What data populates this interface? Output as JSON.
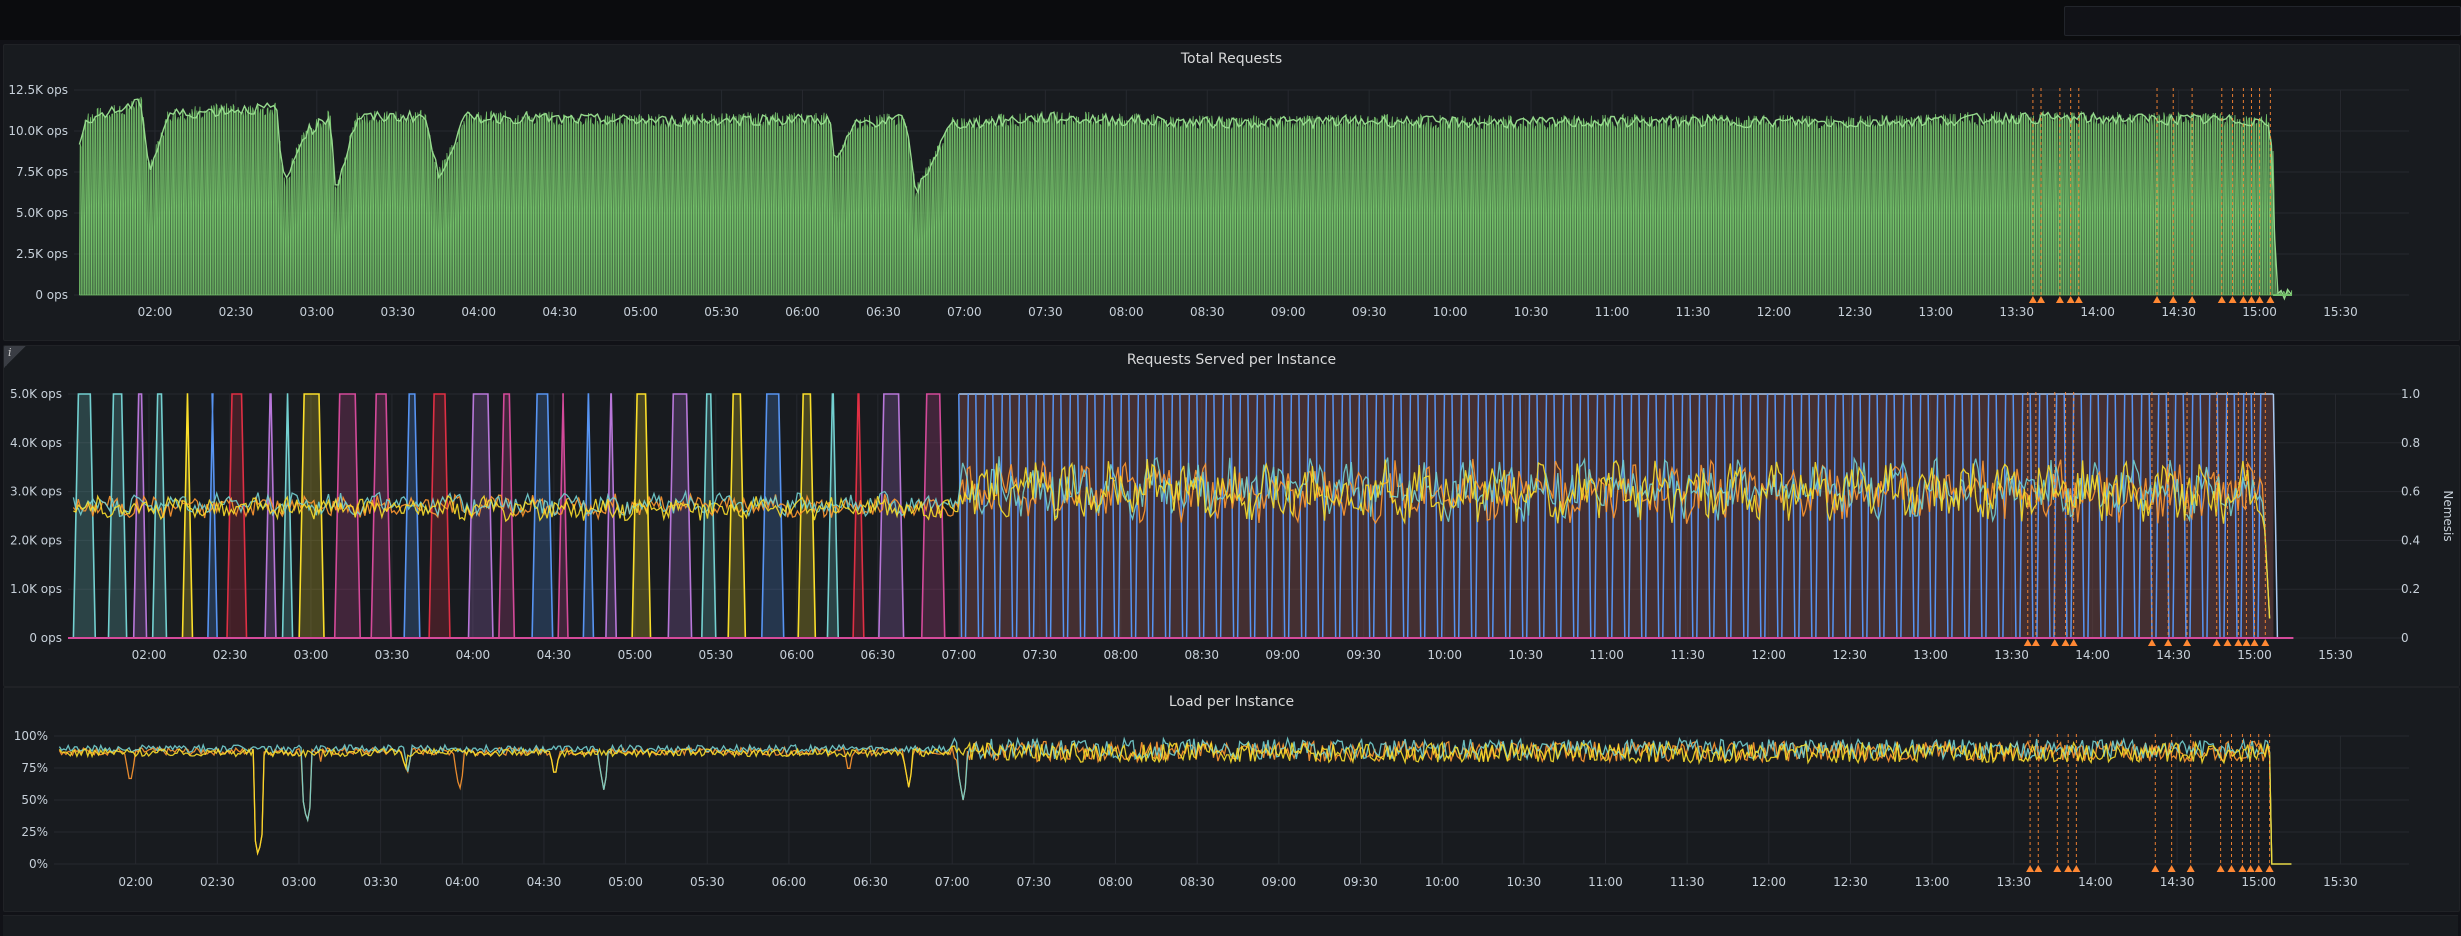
{
  "dashboard": {
    "bottom_title": "",
    "right_axis_label": "Nemesis"
  },
  "colors": {
    "panel_bg": "#181b1f",
    "grid": "#26292f",
    "text": "#c7d0d9",
    "green": "#73bf69",
    "orange": "#ff9830",
    "blue": "#5794f2",
    "red": "#e02f44",
    "purple": "#b877d9",
    "pink": "#d44a9a",
    "yellow": "#fade2a",
    "cyan": "#73d0d0",
    "annotation": "#ff8833"
  },
  "chart_data": [
    {
      "type": "area",
      "title": "Total Requests",
      "xlabel": "",
      "ylabel": "",
      "x_ticks": [
        "02:00",
        "02:30",
        "03:00",
        "03:30",
        "04:00",
        "04:30",
        "05:00",
        "05:30",
        "06:00",
        "06:30",
        "07:00",
        "07:30",
        "08:00",
        "08:30",
        "09:00",
        "09:30",
        "10:00",
        "10:30",
        "11:00",
        "11:30",
        "12:00",
        "12:30",
        "13:00",
        "13:30",
        "14:00",
        "14:30",
        "15:00",
        "15:30"
      ],
      "y_ticks": [
        "0 ops",
        "2.5K ops",
        "5.0K ops",
        "7.5K ops",
        "10.0K ops",
        "12.5K ops"
      ],
      "ylim": [
        0,
        12500
      ],
      "xlim": [
        "01:30",
        "15:35"
      ],
      "series": [
        {
          "name": "",
          "color": "#73bf69",
          "approx_profile": [
            [
              "01:32",
              9000
            ],
            [
              "01:35",
              10800
            ],
            [
              "01:45",
              11200
            ],
            [
              "01:55",
              11700
            ],
            [
              "01:58",
              7500
            ],
            [
              "02:05",
              11000
            ],
            [
              "02:30",
              11300
            ],
            [
              "02:45",
              11400
            ],
            [
              "02:48",
              6600
            ],
            [
              "02:55",
              9800
            ],
            [
              "03:05",
              10900
            ],
            [
              "03:07",
              6400
            ],
            [
              "03:15",
              10800
            ],
            [
              "03:40",
              10900
            ],
            [
              "03:45",
              7200
            ],
            [
              "03:55",
              10800
            ],
            [
              "04:20",
              10800
            ],
            [
              "04:30",
              10700
            ],
            [
              "04:40",
              10700
            ],
            [
              "05:10",
              10600
            ],
            [
              "05:40",
              10700
            ],
            [
              "06:10",
              10700
            ],
            [
              "06:12",
              8000
            ],
            [
              "06:20",
              10500
            ],
            [
              "06:38",
              10700
            ],
            [
              "06:42",
              6200
            ],
            [
              "06:55",
              10400
            ],
            [
              "07:30",
              10800
            ],
            [
              "08:30",
              10500
            ],
            [
              "09:30",
              10600
            ],
            [
              "10:30",
              10500
            ],
            [
              "11:30",
              10600
            ],
            [
              "12:30",
              10500
            ],
            [
              "13:30",
              10800
            ],
            [
              "14:30",
              10700
            ],
            [
              "15:03",
              10600
            ],
            [
              "15:05",
              9000
            ],
            [
              "15:06",
              0
            ],
            [
              "15:12",
              0
            ]
          ],
          "oscillation_low": 0
        }
      ],
      "annotation_times": [
        "13:36",
        "13:39",
        "13:46",
        "13:50",
        "13:53",
        "14:22",
        "14:28",
        "14:35",
        "14:46",
        "14:50",
        "14:54",
        "14:57",
        "15:00",
        "15:04"
      ]
    },
    {
      "type": "line",
      "title": "Requests Served per Instance",
      "xlabel": "",
      "ylabel": "",
      "y2label": "Nemesis",
      "x_ticks": [
        "02:00",
        "02:30",
        "03:00",
        "03:30",
        "04:00",
        "04:30",
        "05:00",
        "05:30",
        "06:00",
        "06:30",
        "07:00",
        "07:30",
        "08:00",
        "08:30",
        "09:00",
        "09:30",
        "10:00",
        "10:30",
        "11:00",
        "11:30",
        "12:00",
        "12:30",
        "13:00",
        "13:30",
        "14:00",
        "14:30",
        "15:00",
        "15:30"
      ],
      "y_ticks": [
        "0 ops",
        "1.0K ops",
        "2.0K ops",
        "3.0K ops",
        "4.0K ops",
        "5.0K ops"
      ],
      "y2_ticks": [
        "0",
        "0.2",
        "0.4",
        "0.6",
        "0.8",
        "1.0"
      ],
      "ylim": [
        0,
        5000
      ],
      "y2lim": [
        0,
        1
      ],
      "xlim": [
        "01:30",
        "15:35"
      ],
      "series": [
        {
          "name": "",
          "color": "#ff9830",
          "approx_level_before_0700": 2700,
          "approx_level_after_0700": 3000
        },
        {
          "name": "",
          "color": "#73d0d0",
          "approx_level_before_0700": 2750,
          "approx_level_after_0700": 3050
        },
        {
          "name": "",
          "color": "#fade2a",
          "approx_level_before_0700": 2650,
          "approx_level_after_0700": 3000
        }
      ],
      "nemesis_right_axis": {
        "value_range": [
          0,
          1
        ],
        "pulse_colors": [
          "#e02f44",
          "#5794f2",
          "#b877d9",
          "#d44a9a",
          "#fade2a",
          "#73d0d0"
        ],
        "active_until": "15:07",
        "background_fill_from": "07:00"
      },
      "annotation_times": [
        "13:36",
        "13:39",
        "13:46",
        "13:50",
        "13:53",
        "14:22",
        "14:28",
        "14:35",
        "14:46",
        "14:50",
        "14:54",
        "14:57",
        "15:00",
        "15:04"
      ]
    },
    {
      "type": "line",
      "title": "Load per Instance",
      "xlabel": "",
      "ylabel": "",
      "x_ticks": [
        "02:00",
        "02:30",
        "03:00",
        "03:30",
        "04:00",
        "04:30",
        "05:00",
        "05:30",
        "06:00",
        "06:30",
        "07:00",
        "07:30",
        "08:00",
        "08:30",
        "09:00",
        "09:30",
        "10:00",
        "10:30",
        "11:00",
        "11:30",
        "12:00",
        "12:30",
        "13:00",
        "13:30",
        "14:00",
        "14:30",
        "15:00",
        "15:30"
      ],
      "y_ticks": [
        "0%",
        "25%",
        "50%",
        "75%",
        "100%"
      ],
      "ylim": [
        0,
        100
      ],
      "xlim": [
        "01:30",
        "15:35"
      ],
      "series": [
        {
          "name": "",
          "color": "#ff9830",
          "approx_level": 88
        },
        {
          "name": "",
          "color": "#73d0d0",
          "approx_level": 90
        },
        {
          "name": "",
          "color": "#fade2a",
          "approx_level": 87
        }
      ],
      "dips": [
        {
          "time": "01:58",
          "value": 62
        },
        {
          "time": "02:45",
          "value": 6
        },
        {
          "time": "03:03",
          "value": 32
        },
        {
          "time": "03:08",
          "value": 80
        },
        {
          "time": "03:39",
          "value": 73
        },
        {
          "time": "03:40",
          "value": 72
        },
        {
          "time": "03:59",
          "value": 57
        },
        {
          "time": "04:34",
          "value": 67
        },
        {
          "time": "04:52",
          "value": 58
        },
        {
          "time": "06:22",
          "value": 70
        },
        {
          "time": "06:44",
          "value": 60
        },
        {
          "time": "07:04",
          "value": 50
        }
      ],
      "drop_time": "15:04",
      "annotation_times": [
        "13:36",
        "13:39",
        "13:46",
        "13:50",
        "13:53",
        "14:22",
        "14:28",
        "14:35",
        "14:46",
        "14:50",
        "14:54",
        "14:57",
        "15:00",
        "15:04"
      ]
    }
  ]
}
